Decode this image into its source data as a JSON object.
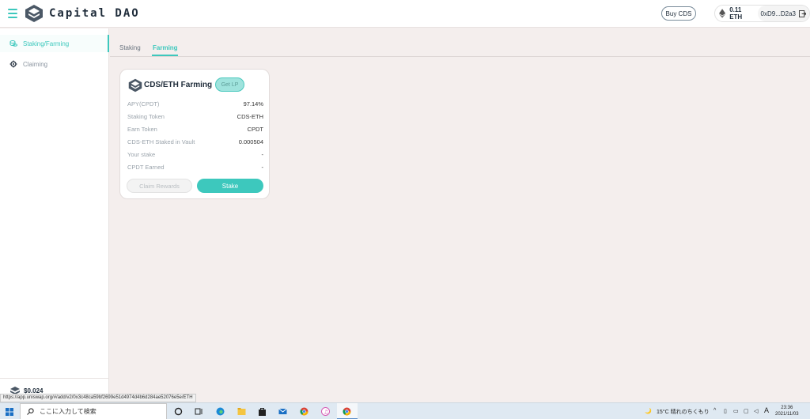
{
  "header": {
    "brand": "Capital DAO",
    "buy_label": "Buy CDS",
    "eth_balance": "0.11 ETH",
    "address": "0xD9...D2a3"
  },
  "sidebar": {
    "items": [
      {
        "label": "Staking/Farming",
        "icon": "coins-icon",
        "active": true
      },
      {
        "label": "Claiming",
        "icon": "gear-icon",
        "active": false
      }
    ],
    "price": "$0.024"
  },
  "tabs": [
    {
      "label": "Staking",
      "active": false
    },
    {
      "label": "Farming",
      "active": true
    }
  ],
  "card": {
    "title": "CDS/ETH Farming",
    "get_lp": "Get LP",
    "rows": [
      {
        "key": "APY(CPDT)",
        "value": "97.14%"
      },
      {
        "key": "Staking Token",
        "value": "CDS-ETH"
      },
      {
        "key": "Earn Token",
        "value": "CPDT"
      },
      {
        "key": "CDS-ETH Staked in Vault",
        "value": "0.000504"
      },
      {
        "key": "Your stake",
        "value": "-"
      },
      {
        "key": "CPDT Earned",
        "value": "-"
      }
    ],
    "claim_label": "Claim Rewards",
    "stake_label": "Stake"
  },
  "status_url": "https://app.uniswap.org/#/add/v2/0x3c48ca59bf2699e51d4974d4b6d284ae52076e5e/ETH",
  "taskbar": {
    "search_placeholder": "ここに入力して検索",
    "weather": "15°C 晴れのちくもり",
    "ime": "A",
    "time": "23:36",
    "date": "2021/11/03"
  },
  "colors": {
    "accent": "#3dc8bd",
    "background": "#f4eeed",
    "text_dark": "#1f2c3a"
  }
}
